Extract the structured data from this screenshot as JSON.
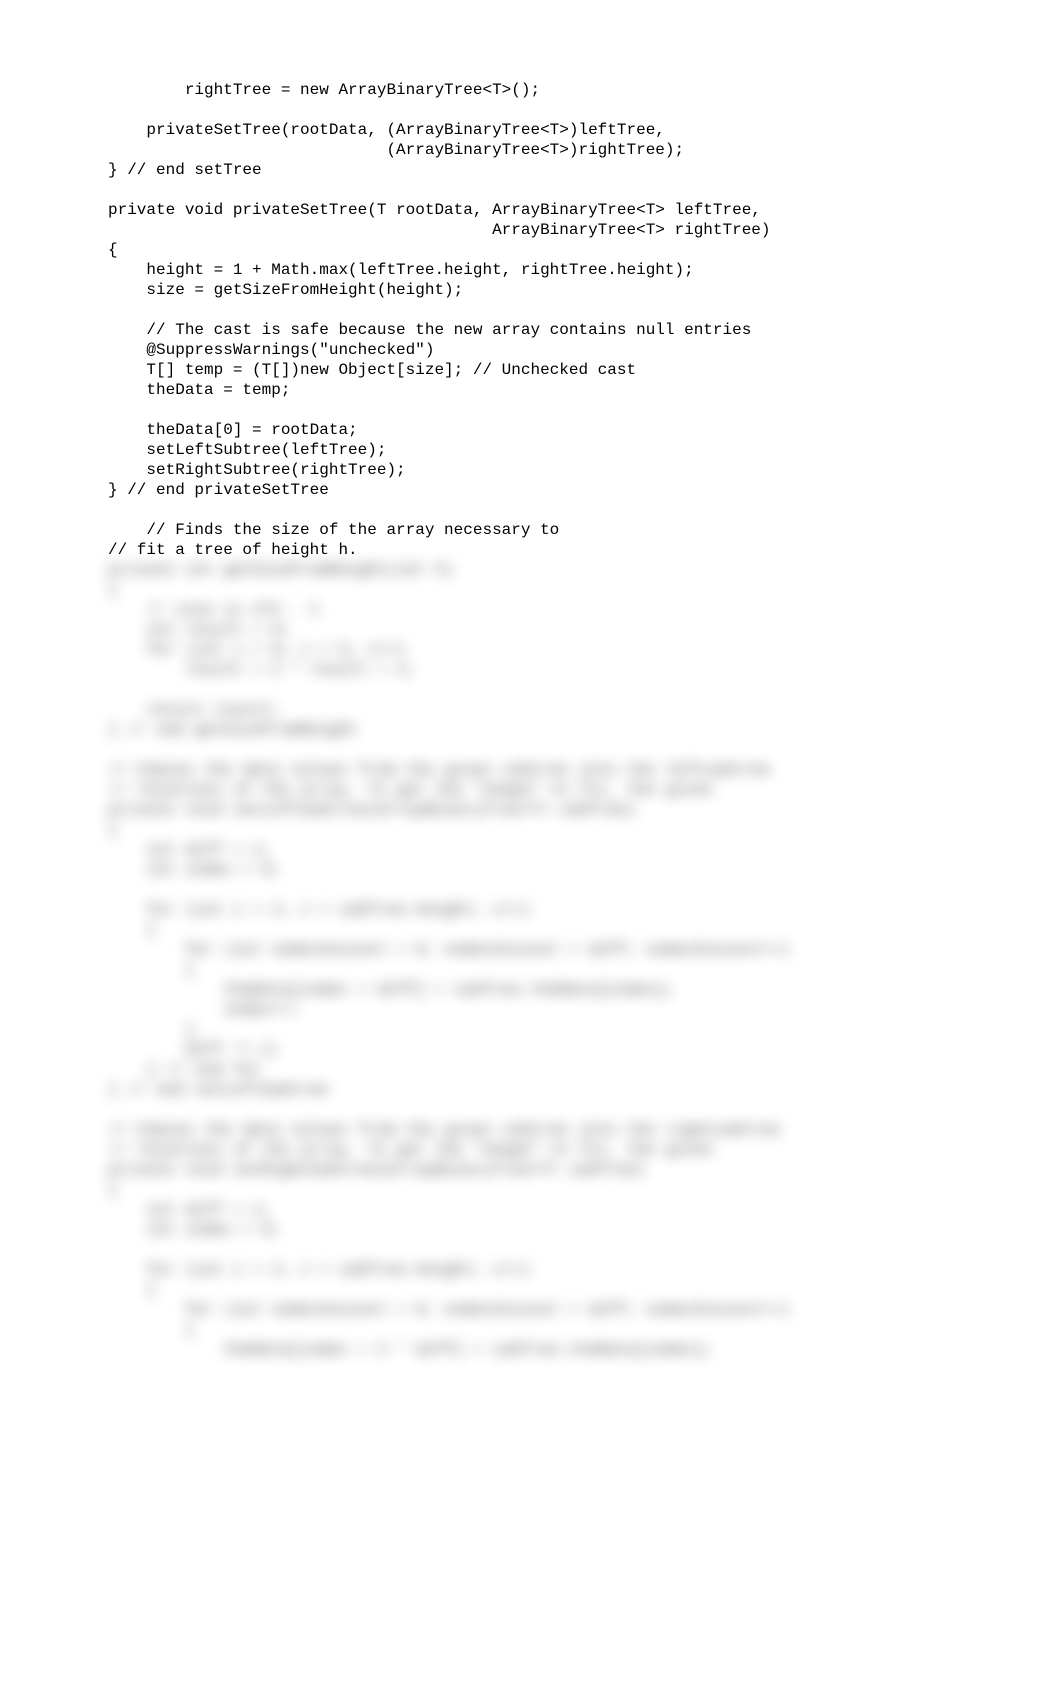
{
  "code": {
    "clear_lines": [
      "        rightTree = new ArrayBinaryTree<T>();",
      "",
      "    privateSetTree(rootData, (ArrayBinaryTree<T>)leftTree,",
      "                             (ArrayBinaryTree<T>)rightTree);",
      "} // end setTree",
      "",
      "private void privateSetTree(T rootData, ArrayBinaryTree<T> leftTree,",
      "                                        ArrayBinaryTree<T> rightTree)",
      "{",
      "    height = 1 + Math.max(leftTree.height, rightTree.height);",
      "    size = getSizeFromHeight(height);",
      "",
      "    // The cast is safe because the new array contains null entries",
      "    @SuppressWarnings(\"unchecked\")",
      "    T[] temp = (T[])new Object[size]; // Unchecked cast",
      "    theData = temp;",
      "",
      "    theData[0] = rootData;",
      "    setLeftSubtree(leftTree);",
      "    setRightSubtree(rightTree);",
      "} // end privateSetTree",
      "",
      "    // Finds the size of the array necessary to",
      "// fit a tree of height h."
    ],
    "blurred_lines": [
      "private int getSizeFromHeight(int h)",
      "{",
      "    // size is 2^h - 1",
      "    int result = 0;",
      "    for (int i = 0; i < h; i++)",
      "        result = 2 * result + 1;",
      "",
      "    return result;",
      "} // end getSizeFromHeight",
      "",
      "// Copies the data values from the given subtree into the leftsubtree",
      "// locations of the array. To get the \"shape\" to fit, the given",
      "private void setLeftSubtree(ArrayBinaryTree<T> subTree)",
      "{",
      "    int diff = 1;",
      "    int index = 0;",
      "",
      "    for (int i = 1; i < subTree.height; i++)",
      "    {",
      "        for (int nodesInLevel = 0; nodesInLevel < diff; nodesInLevel++)",
      "        {",
      "            theData[index + diff] = subTree.theData[index];",
      "            index++;",
      "        }",
      "        diff *= 2;",
      "    } // end for",
      "} // end setLeftSubtree",
      "",
      "// Copies the data values from the given subtree into the rightsubtree",
      "// locations of the array. To get the \"shape\" to fit, the given",
      "private void setRightSubtree(ArrayBinaryTree<T> subTree)",
      "{",
      "    int diff = 1;",
      "    int index = 0;",
      "",
      "    for (int i = 1; i < subTree.height; i++)",
      "    {",
      "        for (int nodesInLevel = 0; nodesInLevel < diff; nodesInLevel++)",
      "        {",
      "            theData[index + 2 * diff] = subTree.theData[index];"
    ]
  }
}
